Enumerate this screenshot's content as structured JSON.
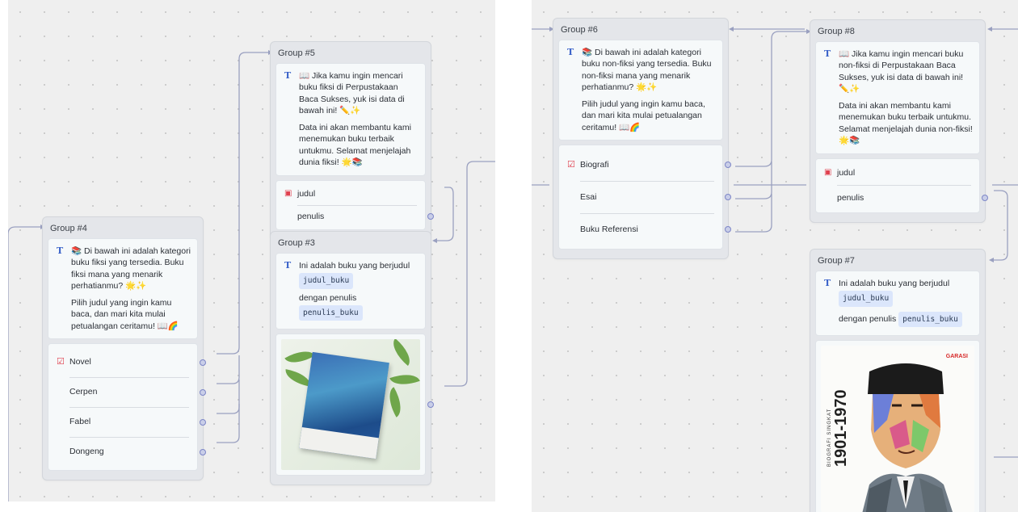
{
  "left": {
    "group4": {
      "title": "Group #4",
      "text1": "📚 Di bawah ini adalah kategori buku fiksi yang tersedia. Buku fiksi mana yang menarik perhatianmu? 🌟✨",
      "text2": "Pilih judul yang ingin kamu baca, dan mari kita mulai petualangan ceritamu! 📖🌈",
      "choices": [
        "Novel",
        "Cerpen",
        "Fabel",
        "Dongeng"
      ]
    },
    "group5": {
      "title": "Group #5",
      "text1": "📖 Jika kamu ingin mencari buku fiksi di Perpustakaan Baca Sukses, yuk isi data di bawah ini! ✏️✨",
      "text2": "Data ini akan membantu kami menemukan buku terbaik untukmu. Selamat menjelajah dunia fiksi! 🌟📚",
      "fields": [
        "judul",
        "penulis"
      ]
    },
    "group3": {
      "title": "Group #3",
      "text1": "Ini adalah buku yang berjudul",
      "tag1": "judul_buku",
      "text2": "dengan penulis",
      "tag2": "penulis_buku"
    }
  },
  "right": {
    "group6": {
      "title": "Group #6",
      "text1": "📚 Di bawah ini adalah kategori buku non-fiksi yang tersedia. Buku non-fiksi mana yang menarik perhatianmu? 🌟✨",
      "text2": "Pilih judul yang ingin kamu baca, dan mari kita mulai petualangan ceritamu! 📖🌈",
      "choices": [
        "Biografi",
        "Esai",
        "Buku Referensi"
      ]
    },
    "group8": {
      "title": "Group #8",
      "text1": "📖 Jika kamu ingin mencari buku non-fiksi di Perpustakaan Baca Sukses, yuk isi data di bawah ini! ✏️✨",
      "text2": "Data ini akan membantu kami menemukan buku terbaik untukmu. Selamat menjelajah dunia non-fiksi! 🌟📚",
      "fields": [
        "judul",
        "penulis"
      ]
    },
    "group7": {
      "title": "Group #7",
      "text1": "Ini adalah buku yang berjudul",
      "tag1": "judul_buku",
      "text2": "dengan penulis",
      "tag2": "penulis_buku",
      "cover_text": "1901-1970",
      "cover_subtext": "BIOGRAFI SINGKAT",
      "cover_brand": "GARASI"
    }
  },
  "icons": {
    "text_block": "T",
    "choice": "☑",
    "field": "▣"
  },
  "colors": {
    "canvas": "#efefef",
    "group_bg": "#e4e6ea",
    "card_bg": "#f6f9fa",
    "edge": "#8d93b8",
    "tag_bg": "#dbe6fb",
    "accent_icon": "#e0414f"
  }
}
